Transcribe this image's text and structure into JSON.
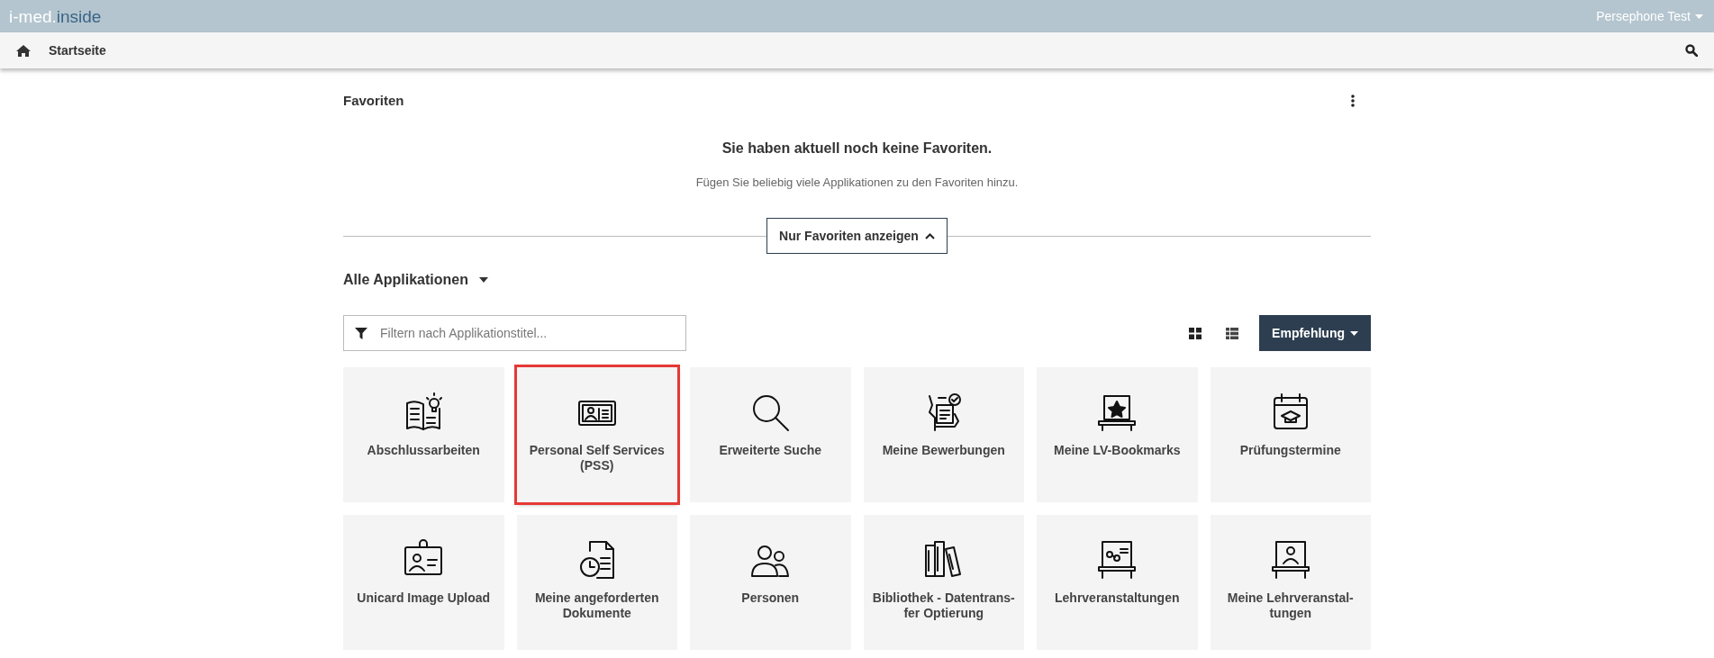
{
  "top_bar": {
    "logo_part_1": "i-med.",
    "logo_part_2": "inside",
    "user_menu": "Persephone Test"
  },
  "nav_bar": {
    "breadcrumb": "Startseite"
  },
  "favorites": {
    "title": "Favoriten",
    "empty_title": "Sie haben aktuell noch keine Favoriten.",
    "empty_text": "Fügen Sie beliebig viele Applikationen zu den Favoriten hinzu.",
    "toggle_button": "Nur Favoriten anzeigen"
  },
  "applications": {
    "title": "Alle Applikationen",
    "filter": {
      "placeholder": "Filtern nach Applikationstitel..."
    },
    "view_grid_selected": true,
    "sort_button": "Empfehlung",
    "tiles": [
      {
        "lines": [
          "Abschlussarbeiten"
        ],
        "highlighted": false
      },
      {
        "lines": [
          "Personal Self Services",
          "(PSS)"
        ],
        "highlighted": true
      },
      {
        "lines": [
          "Erweiterte Suche"
        ],
        "highlighted": false
      },
      {
        "lines": [
          "Meine Bewerbungen"
        ],
        "highlighted": false
      },
      {
        "lines": [
          "Meine LV-Bookmarks"
        ],
        "highlighted": false
      },
      {
        "lines": [
          "Prüfungstermine"
        ],
        "highlighted": false
      },
      {
        "lines": [
          "Unicard Image Upload"
        ],
        "highlighted": false
      },
      {
        "lines": [
          "Meine angeforderten",
          "Dokumente"
        ],
        "highlighted": false
      },
      {
        "lines": [
          "Personen"
        ],
        "highlighted": false
      },
      {
        "lines": [
          "Bibliothek - Datentrans-",
          "fer Optierung"
        ],
        "highlighted": false
      },
      {
        "lines": [
          "Lehrveranstaltungen"
        ],
        "highlighted": false
      },
      {
        "lines": [
          "Meine Lehrveranstal-",
          "tungen"
        ],
        "highlighted": false
      }
    ]
  }
}
